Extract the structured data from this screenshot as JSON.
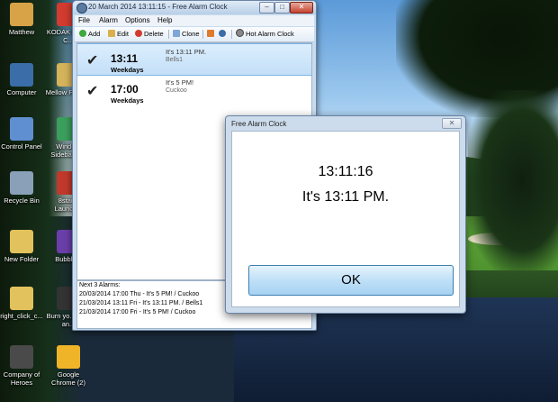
{
  "desktop": {
    "icons": [
      {
        "label": "Matthew",
        "color": "#d8a347"
      },
      {
        "label": "KODAK Home C...",
        "color": "#d23b2f"
      },
      {
        "label": "Computer",
        "color": "#3b6ea8"
      },
      {
        "label": "Mellow Place...",
        "color": "#d4b35a"
      },
      {
        "label": "Control Panel",
        "color": "#5f8fd0"
      },
      {
        "label": "Windo... Sidebar S...",
        "color": "#3a9e5c"
      },
      {
        "label": "Recycle Bin",
        "color": "#8aa0b8"
      },
      {
        "label": "8star... Launch...",
        "color": "#c0392b"
      },
      {
        "label": "New Folder",
        "color": "#e2c25c"
      },
      {
        "label": "Bubble...",
        "color": "#6a3ea8"
      },
      {
        "label": "right_click_c...",
        "color": "#e2c25c"
      },
      {
        "label": "Burn yo... CDs an...",
        "color": "#333333"
      },
      {
        "label": "Company of Heroes",
        "color": "#4a4a4a"
      },
      {
        "label": "Google Chrome (2)",
        "color": "#f0b429"
      }
    ]
  },
  "main_window": {
    "title": "20 March 2014 13:11:15 - Free Alarm Clock",
    "controls": {
      "minimize": "–",
      "maximize": "□",
      "close": "✕"
    },
    "menu": [
      "File",
      "Alarm",
      "Options",
      "Help"
    ],
    "toolbar": {
      "add": "Add",
      "edit": "Edit",
      "delete": "Delete",
      "clone": "Clone",
      "hot_alarm": "Hot Alarm Clock"
    },
    "alarms": [
      {
        "check": "✔",
        "time": "13:11",
        "days": "Weekdays",
        "message": "It's 13:11 PM.",
        "sound": "Bells1"
      },
      {
        "check": "✔",
        "time": "17:00",
        "days": "Weekdays",
        "message": "It's 5 PM!",
        "sound": "Cuckoo"
      }
    ],
    "next_alarms": {
      "heading": "Next 3 Alarms:",
      "lines": [
        "20/03/2014 17:00 Thu - It's 5 PM! / Cuckoo",
        "21/03/2014 13:11 Fri - It's 13:11 PM. / Bells1",
        "21/03/2014 17:00 Fri - It's 5 PM! / Cuckoo"
      ]
    }
  },
  "popup": {
    "title": "Free Alarm Clock",
    "close": "✕",
    "time": "13:11:16",
    "message": "It's 13:11 PM.",
    "ok_label": "OK"
  },
  "colors": {
    "selection": "#c3dff8",
    "ok_button": "#bfe0f7",
    "window_frame": "#c9dcef"
  }
}
